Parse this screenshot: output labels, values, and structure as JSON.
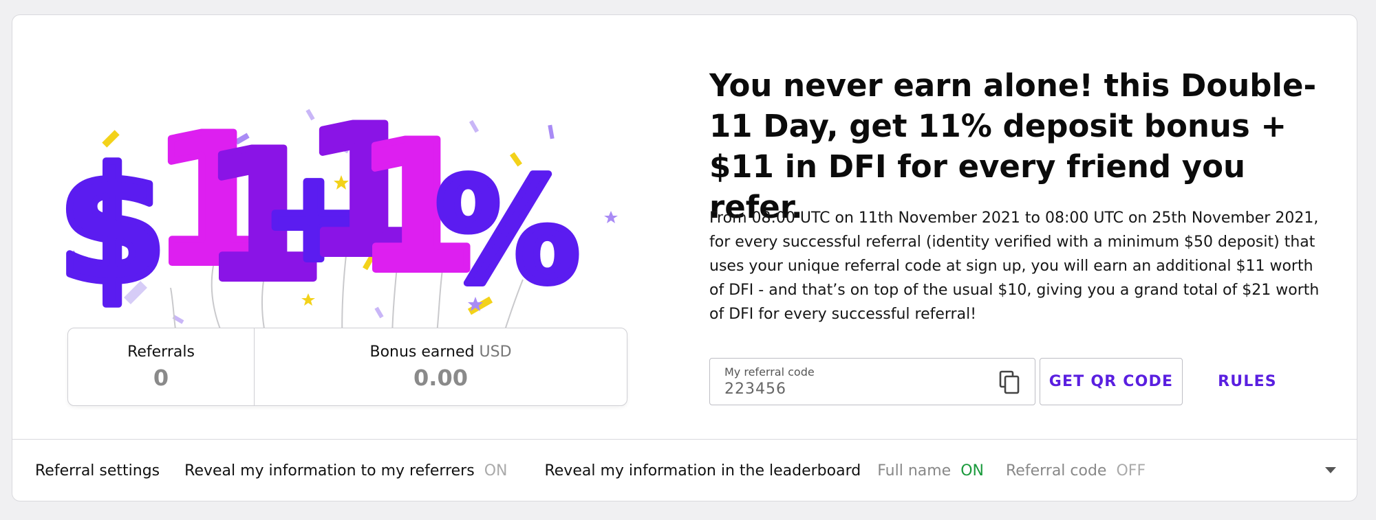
{
  "headline": "You never earn alone! this Double-11 Day, get 11% deposit bonus + $11 in DFI for every friend you refer.",
  "description": "From 08:00 UTC on 11th November 2021 to 08:00 UTC on 25th November 2021, for every successful referral (identity verified with a minimum $50 deposit) that uses your unique referral code at sign up, you will earn an additional $11 worth of DFI - and that’s on top of the usual $10, giving you a grand total of $21 worth of DFI  for every successful referral!",
  "promo_art": {
    "chars": [
      "$",
      "1",
      "1",
      "+",
      "1",
      "1",
      "%"
    ],
    "colors": [
      "#5b1cf0",
      "#dd1ff0",
      "#8a14e6",
      "#5b1cf0",
      "#8a14e6",
      "#dd1ff0",
      "#5b1cf0"
    ]
  },
  "stats": {
    "referrals_label": "Referrals",
    "referrals_value": "0",
    "bonus_label": "Bonus earned",
    "bonus_unit": "USD",
    "bonus_value": "0.00"
  },
  "referral_code": {
    "label": "My referral code",
    "value": "223456",
    "copy_icon": "copy-icon"
  },
  "buttons": {
    "qr": "GET QR CODE",
    "rules": "RULES"
  },
  "settings": {
    "title": "Referral settings",
    "reveal_referrers_label": "Reveal my information to my referrers",
    "reveal_referrers_state": "ON",
    "reveal_leaderboard_label": "Reveal my information in the leaderboard",
    "full_name_label": "Full name",
    "full_name_state": "ON",
    "referral_code_label": "Referral code",
    "referral_code_state": "OFF"
  },
  "colors": {
    "accent": "#5a1fe0",
    "on": "#1a9a3c",
    "off": "#aaaaaa"
  }
}
